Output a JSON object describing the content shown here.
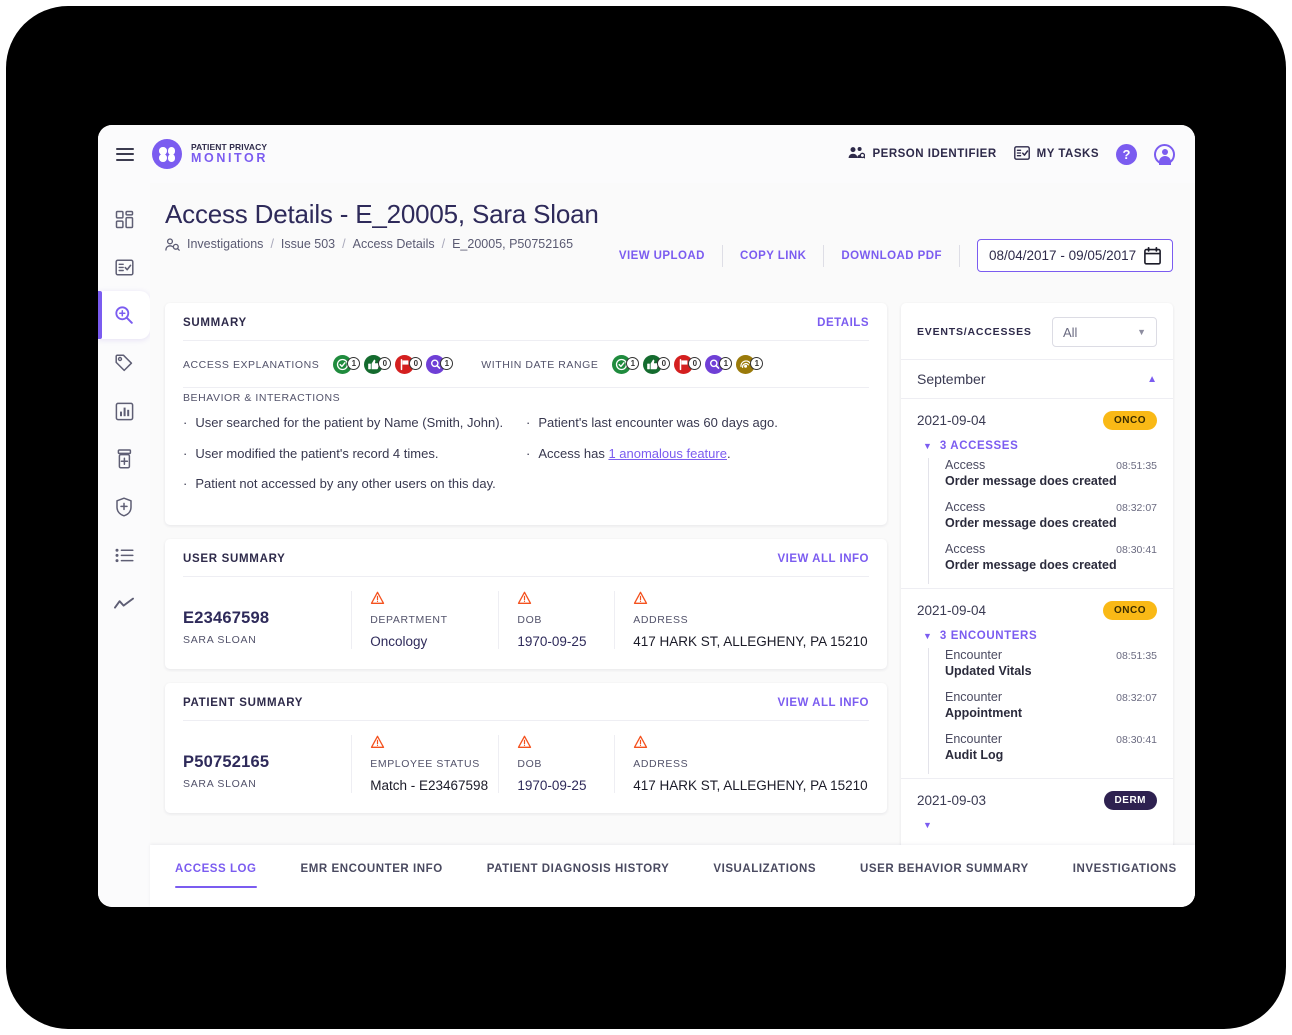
{
  "brand": {
    "line1": "PATIENT PRIVACY",
    "line2": "MONITOR"
  },
  "topbar": {
    "person_identifier": "PERSON IDENTIFIER",
    "my_tasks": "MY TASKS",
    "help_glyph": "?"
  },
  "sidebar": {
    "items": [
      {
        "name": "dashboard",
        "label": "Dashboard"
      },
      {
        "name": "tasks",
        "label": "Tasks"
      },
      {
        "name": "investigate",
        "label": "Investigate"
      },
      {
        "name": "tags",
        "label": "Tags"
      },
      {
        "name": "reports",
        "label": "Reports"
      },
      {
        "name": "pharmacy",
        "label": "Pharmacy"
      },
      {
        "name": "security",
        "label": "Security"
      },
      {
        "name": "lists",
        "label": "Lists"
      },
      {
        "name": "trends",
        "label": "Trends"
      }
    ]
  },
  "header": {
    "title": "Access Details - E_20005, Sara Sloan",
    "breadcrumb": [
      "Investigations",
      "Issue 503",
      "Access Details",
      "E_20005, P50752165"
    ],
    "actions": [
      "VIEW UPLOAD",
      "COPY LINK",
      "DOWNLOAD PDF"
    ],
    "date_range": "08/04/2017 - 09/05/2017"
  },
  "summary": {
    "title": "SUMMARY",
    "details_link": "DETAILS",
    "access_explanations_label": "ACCESS EXPLANATIONS",
    "within_date_range_label": "WITHIN DATE RANGE",
    "access_explanations": [
      {
        "icon": "check-circle-icon",
        "count": "1",
        "color": "#1f8b3d"
      },
      {
        "icon": "thumbs-up-icon",
        "count": "0",
        "color": "#146b2e"
      },
      {
        "icon": "flag-icon",
        "count": "0",
        "color": "#d41f1f"
      },
      {
        "icon": "magnifier-icon",
        "count": "1",
        "color": "#6f3fd6"
      }
    ],
    "within_date_range": [
      {
        "icon": "check-circle-icon",
        "count": "1",
        "color": "#1f8b3d"
      },
      {
        "icon": "thumbs-up-icon",
        "count": "0",
        "color": "#146b2e"
      },
      {
        "icon": "flag-icon",
        "count": "0",
        "color": "#d41f1f"
      },
      {
        "icon": "magnifier-icon",
        "count": "1",
        "color": "#6f3fd6"
      },
      {
        "icon": "fingerprint-icon",
        "count": "1",
        "color": "#9a7a09"
      }
    ],
    "behavior_title": "BEHAVIOR & INTERACTIONS",
    "behavior_left": [
      "User searched for the patient by Name (Smith, John).",
      "User modified the patient's record 4 times.",
      "Patient not accessed by any other users on this day."
    ],
    "behavior_right_1_pre": "Patient's last encounter was 60 days ago.",
    "behavior_right_2_pre": "Access has ",
    "behavior_right_2_link": "1 anomalous feature",
    "behavior_right_2_post": "."
  },
  "user_summary": {
    "title": "USER SUMMARY",
    "link": "VIEW ALL INFO",
    "id": "E23467598",
    "name": "SARA SLOAN",
    "fields": [
      {
        "key": "DEPARTMENT",
        "value": "Oncology"
      },
      {
        "key": "DOB",
        "value": "1970-09-25"
      },
      {
        "key": "ADDRESS",
        "value": "417 HARK ST, ALLEGHENY, PA 15210"
      }
    ]
  },
  "patient_summary": {
    "title": "PATIENT SUMMARY",
    "link": "VIEW ALL INFO",
    "id": "P50752165",
    "name": "SARA SLOAN",
    "fields": [
      {
        "key": "EMPLOYEE STATUS",
        "value": "Match - E23467598"
      },
      {
        "key": "DOB",
        "value": "1970-09-25"
      },
      {
        "key": "ADDRESS",
        "value": "417 HARK ST, ALLEGHENY, PA 15210"
      }
    ]
  },
  "events_panel": {
    "title": "EVENTS/ACCESSES",
    "filter_value": "All",
    "month": "September",
    "groups": [
      {
        "date": "2021-09-04",
        "tag": "ONCO",
        "tag_bg": "#f9b916",
        "tag_fg": "#3a2c00",
        "toggle": "3 ACCESSES",
        "events": [
          {
            "kind": "Access",
            "time": "08:51:35",
            "desc": "Order message does created"
          },
          {
            "kind": "Access",
            "time": "08:32:07",
            "desc": "Order message does created"
          },
          {
            "kind": "Access",
            "time": "08:30:41",
            "desc": "Order message does created"
          }
        ]
      },
      {
        "date": "2021-09-04",
        "tag": "ONCO",
        "tag_bg": "#f9b916",
        "tag_fg": "#3a2c00",
        "toggle": "3 ENCOUNTERS",
        "events": [
          {
            "kind": "Encounter",
            "time": "08:51:35",
            "desc": "Updated Vitals"
          },
          {
            "kind": "Encounter",
            "time": "08:32:07",
            "desc": "Appointment"
          },
          {
            "kind": "Encounter",
            "time": "08:30:41",
            "desc": "Audit Log"
          }
        ]
      },
      {
        "date": "2021-09-03",
        "tag": "DERM",
        "tag_bg": "#2e2150",
        "tag_fg": "#ffffff",
        "toggle": "",
        "events": []
      }
    ]
  },
  "tabs": [
    {
      "label": "ACCESS LOG",
      "active": true
    },
    {
      "label": "EMR ENCOUNTER INFO",
      "active": false
    },
    {
      "label": "PATIENT DIAGNOSIS HISTORY",
      "active": false
    },
    {
      "label": "VISUALIZATIONS",
      "active": false
    },
    {
      "label": "USER BEHAVIOR SUMMARY",
      "active": false
    },
    {
      "label": "INVESTIGATIONS",
      "active": false
    }
  ],
  "colors": {
    "accent": "#7b5cf0",
    "ink": "#2e2a5a",
    "warn": "#f4511e"
  }
}
